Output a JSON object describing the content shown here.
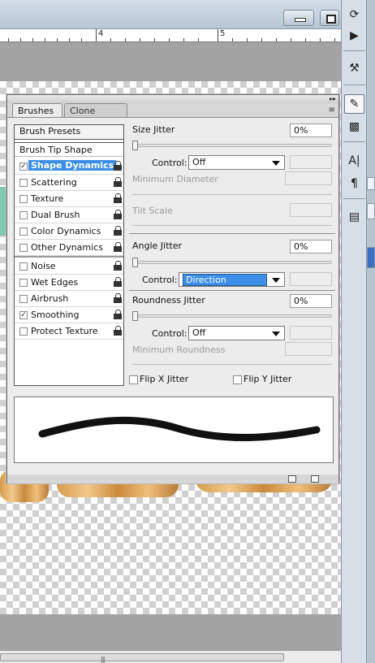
{
  "ruler": {
    "labels": [
      "4",
      "5"
    ]
  },
  "panel": {
    "tabs": {
      "brushes": "Brushes",
      "brushes_close": "×",
      "clone_source": "Clone Source"
    },
    "left": {
      "presets": "Brush Presets",
      "tip_shape": "Brush Tip Shape",
      "options": [
        {
          "label": "Shape Dynamics",
          "checked": true,
          "selected": true
        },
        {
          "label": "Scattering",
          "checked": false
        },
        {
          "label": "Texture",
          "checked": false
        },
        {
          "label": "Dual Brush",
          "checked": false
        },
        {
          "label": "Color Dynamics",
          "checked": false
        },
        {
          "label": "Other Dynamics",
          "checked": false
        },
        {
          "label": "Noise",
          "checked": false
        },
        {
          "label": "Wet Edges",
          "checked": false
        },
        {
          "label": "Airbrush",
          "checked": false
        },
        {
          "label": "Smoothing",
          "checked": true
        },
        {
          "label": "Protect Texture",
          "checked": false
        }
      ]
    },
    "right": {
      "size_jitter": {
        "label": "Size Jitter",
        "value": "0%"
      },
      "size_control": {
        "label": "Control:",
        "value": "Off"
      },
      "min_diameter": "Minimum Diameter",
      "tilt_scale": "Tilt Scale",
      "angle_jitter": {
        "label": "Angle Jitter",
        "value": "0%"
      },
      "angle_control": {
        "label": "Control:",
        "value": "Direction"
      },
      "roundness_jitter": {
        "label": "Roundness Jitter",
        "value": "0%"
      },
      "roundness_control": {
        "label": "Control:",
        "value": "Off"
      },
      "min_roundness": "Minimum Roundness",
      "flip_x": "Flip X Jitter",
      "flip_y": "Flip Y Jitter"
    }
  },
  "scrollbar": {
    "grip": "|||"
  }
}
